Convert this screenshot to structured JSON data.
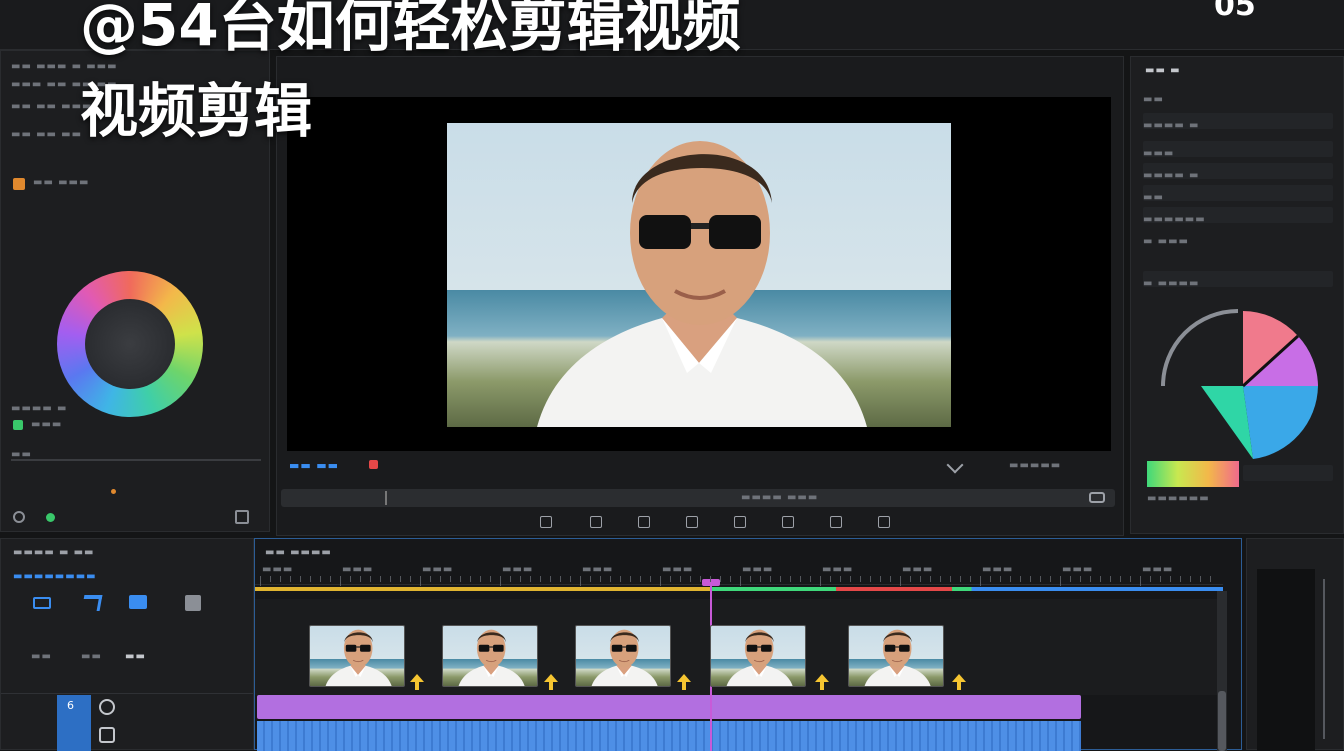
{
  "overlay": {
    "title_line1": "@54台如何轻松剪辑视频",
    "title_line2": "视频剪辑",
    "corner_text": "05"
  },
  "left_panel": {
    "rows": [
      "▬▬ ▬▬▬ ▬ ▬▬▬",
      "▬▬▬ ▬▬ ▬▬ ▬▬",
      "▬▬ ▬▬ ▬▬▬",
      "▬▬ ▬▬ ▬▬"
    ],
    "section_label": "▬▬ ▬▬▬",
    "slider_labels": [
      "▬▬▬▬ ▬",
      "▬▬▬",
      "▬▬"
    ]
  },
  "viewer": {
    "status_label": "▬▬ ▬▬",
    "right_label": "▬▬▬▬▬",
    "timecode_label": "▬▬▬▬ ▬▬▬",
    "toolbar_icons": [
      "clip-icon",
      "grid-icon",
      "book-icon",
      "list-icon",
      "crop-icon",
      "link-icon",
      "zoom-icon",
      "flag-icon"
    ]
  },
  "right_panel": {
    "title": "▬▬ ▬",
    "rows": [
      "▬▬",
      "▬▬▬▬ ▬",
      "▬▬▬",
      "▬▬▬▬ ▬",
      "▬▬",
      "▬▬▬▬▬▬",
      "▬ ▬▬▬",
      "▬ ▬▬▬▬"
    ],
    "gradient_label": "▬▬▬▬▬▬"
  },
  "timeline_left": {
    "header": "▬▬▬▬ ▬ ▬▬",
    "subheader": "▬▬▬▬▬▬▬▬",
    "track_labels": [
      "▬▬",
      "▬▬",
      "▬▬"
    ],
    "layer_numbers": [
      "6",
      "▬"
    ]
  },
  "timeline": {
    "header": "▬▬ ▬▬▬▬",
    "ruler_labels": [
      "▬▬▬",
      "▬▬▬",
      "▬▬▬",
      "▬▬▬",
      "▬▬▬",
      "▬▬▬",
      "▬▬▬",
      "▬▬▬",
      "▬▬▬",
      "▬▬▬",
      "▬▬▬",
      "▬▬▬"
    ],
    "playhead_fraction": 0.47
  },
  "colors": {
    "accent_blue": "#3a8df0",
    "clip_purple": "#b26fe0",
    "audio_blue": "#4e8fe6",
    "playhead": "#c85ad8",
    "arrow_yellow": "#f6c531"
  }
}
